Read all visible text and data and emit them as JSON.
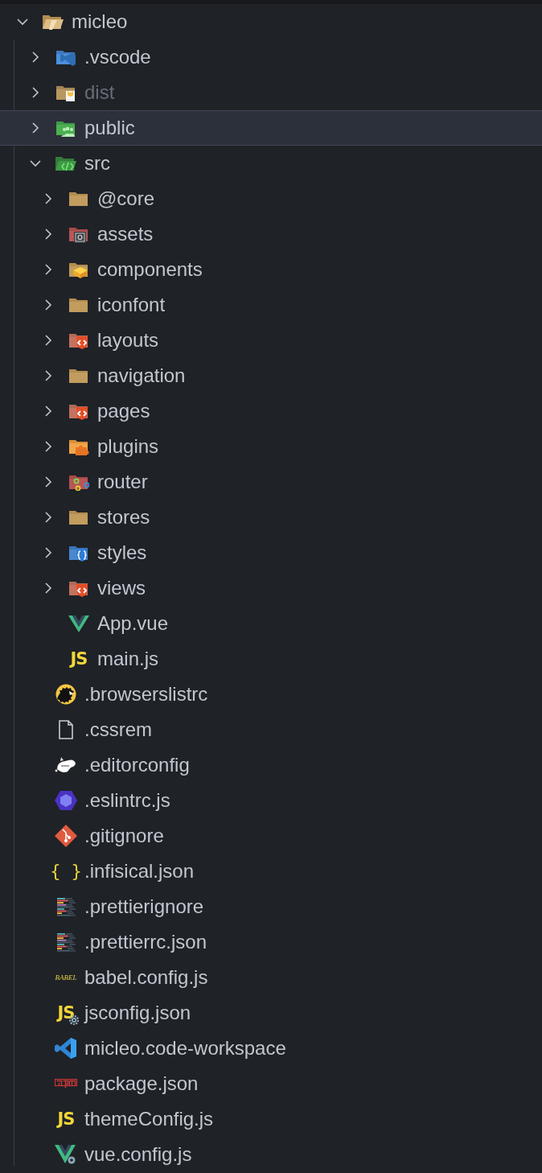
{
  "explorer": {
    "tree": [
      {
        "label": "micleo",
        "kind": "folder",
        "expanded": true,
        "selected": false,
        "ignored": false,
        "children": [
          {
            "label": ".vscode",
            "kind": "folder",
            "expanded": false,
            "selected": false,
            "ignored": false
          },
          {
            "label": "dist",
            "kind": "folder",
            "expanded": false,
            "selected": false,
            "ignored": true
          },
          {
            "label": "public",
            "kind": "folder",
            "expanded": false,
            "selected": true,
            "ignored": false
          },
          {
            "label": "src",
            "kind": "folder",
            "expanded": true,
            "selected": false,
            "ignored": false,
            "children": [
              {
                "label": "@core",
                "kind": "folder",
                "expanded": false,
                "selected": false,
                "ignored": false
              },
              {
                "label": "assets",
                "kind": "folder",
                "expanded": false,
                "selected": false,
                "ignored": false
              },
              {
                "label": "components",
                "kind": "folder",
                "expanded": false,
                "selected": false,
                "ignored": false
              },
              {
                "label": "iconfont",
                "kind": "folder",
                "expanded": false,
                "selected": false,
                "ignored": false
              },
              {
                "label": "layouts",
                "kind": "folder",
                "expanded": false,
                "selected": false,
                "ignored": false
              },
              {
                "label": "navigation",
                "kind": "folder",
                "expanded": false,
                "selected": false,
                "ignored": false
              },
              {
                "label": "pages",
                "kind": "folder",
                "expanded": false,
                "selected": false,
                "ignored": false
              },
              {
                "label": "plugins",
                "kind": "folder",
                "expanded": false,
                "selected": false,
                "ignored": false
              },
              {
                "label": "router",
                "kind": "folder",
                "expanded": false,
                "selected": false,
                "ignored": false
              },
              {
                "label": "stores",
                "kind": "folder",
                "expanded": false,
                "selected": false,
                "ignored": false
              },
              {
                "label": "styles",
                "kind": "folder",
                "expanded": false,
                "selected": false,
                "ignored": false
              },
              {
                "label": "views",
                "kind": "folder",
                "expanded": false,
                "selected": false,
                "ignored": false
              },
              {
                "label": "App.vue",
                "kind": "file",
                "selected": false,
                "ignored": false
              },
              {
                "label": "main.js",
                "kind": "file",
                "badge": "JS",
                "selected": false,
                "ignored": false
              }
            ]
          },
          {
            "label": ".browserslistrc",
            "kind": "file",
            "selected": false,
            "ignored": false
          },
          {
            "label": ".cssrem",
            "kind": "file",
            "selected": false,
            "ignored": false
          },
          {
            "label": ".editorconfig",
            "kind": "file",
            "selected": false,
            "ignored": false
          },
          {
            "label": ".eslintrc.js",
            "kind": "file",
            "selected": false,
            "ignored": false
          },
          {
            "label": ".gitignore",
            "kind": "file",
            "selected": false,
            "ignored": false
          },
          {
            "label": ".infisical.json",
            "kind": "file",
            "badge": "{ }",
            "selected": false,
            "ignored": false
          },
          {
            "label": ".prettierignore",
            "kind": "file",
            "selected": false,
            "ignored": false
          },
          {
            "label": ".prettierrc.json",
            "kind": "file",
            "selected": false,
            "ignored": false
          },
          {
            "label": "babel.config.js",
            "kind": "file",
            "badge": "BABEL",
            "selected": false,
            "ignored": false
          },
          {
            "label": "jsconfig.json",
            "kind": "file",
            "badge": "JS",
            "selected": false,
            "ignored": false
          },
          {
            "label": "micleo.code-workspace",
            "kind": "file",
            "selected": false,
            "ignored": false
          },
          {
            "label": "package.json",
            "kind": "file",
            "selected": false,
            "ignored": false
          },
          {
            "label": "themeConfig.js",
            "kind": "file",
            "badge": "JS",
            "selected": false,
            "ignored": false
          },
          {
            "label": "vue.config.js",
            "kind": "file",
            "selected": false,
            "ignored": false
          }
        ]
      }
    ]
  }
}
